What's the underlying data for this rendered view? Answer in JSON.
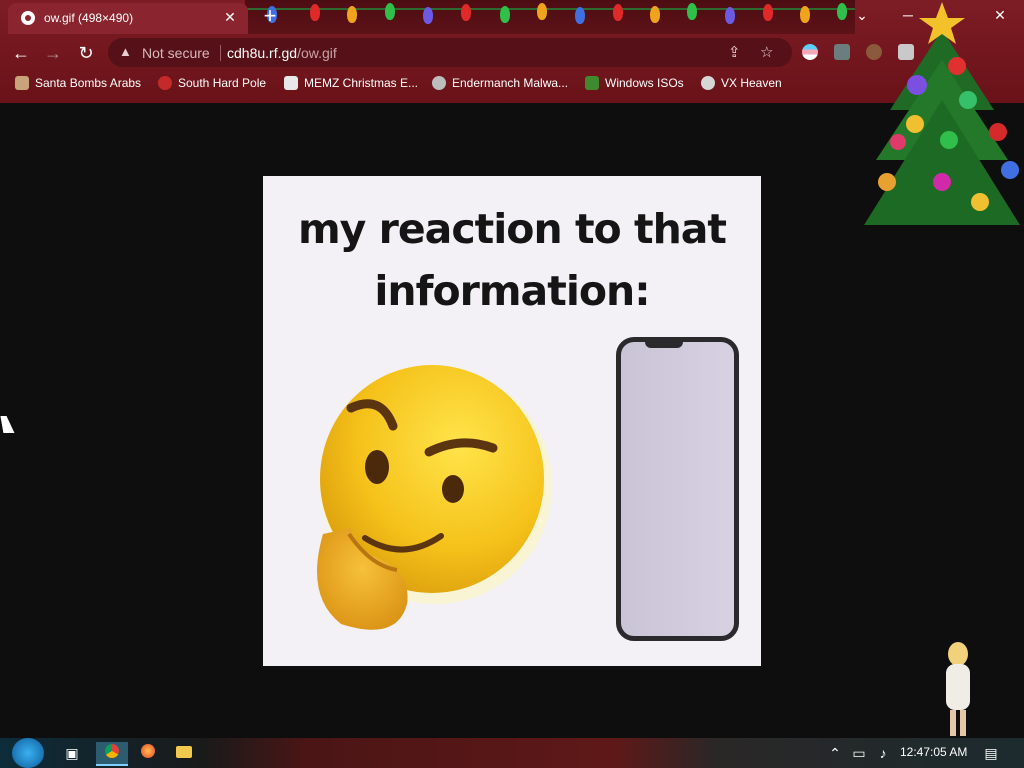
{
  "tab": {
    "title": "ow.gif (498×490)",
    "close": "✕",
    "new": "+"
  },
  "window": {
    "dropdown": "⌄",
    "minimize": "─",
    "close": "✕"
  },
  "nav": {
    "back": "←",
    "forward": "→",
    "reload": "↻"
  },
  "address": {
    "security": "Not secure",
    "host": "cdh8u.rf.gd",
    "path": "/ow.gif"
  },
  "bookmarks": [
    {
      "label": "Santa Bombs Arabs",
      "icon": "santa-icon"
    },
    {
      "label": "South Hard Pole",
      "icon": "snowflake-icon"
    },
    {
      "label": "MEMZ Christmas E...",
      "icon": "page-icon"
    },
    {
      "label": "Endermanch Malwa...",
      "icon": "face-icon"
    },
    {
      "label": "Windows ISOs",
      "icon": "tree-icon"
    },
    {
      "label": "VX Heaven",
      "icon": "skull-icon"
    }
  ],
  "gif": {
    "caption_line1": "my reaction to that",
    "caption_line2": "information:"
  },
  "taskbar": {
    "clock": "12:47:05 AM"
  },
  "colors": {
    "frame": "#6a1219",
    "omnibox": "#561017",
    "page": "#0e0e0e"
  }
}
